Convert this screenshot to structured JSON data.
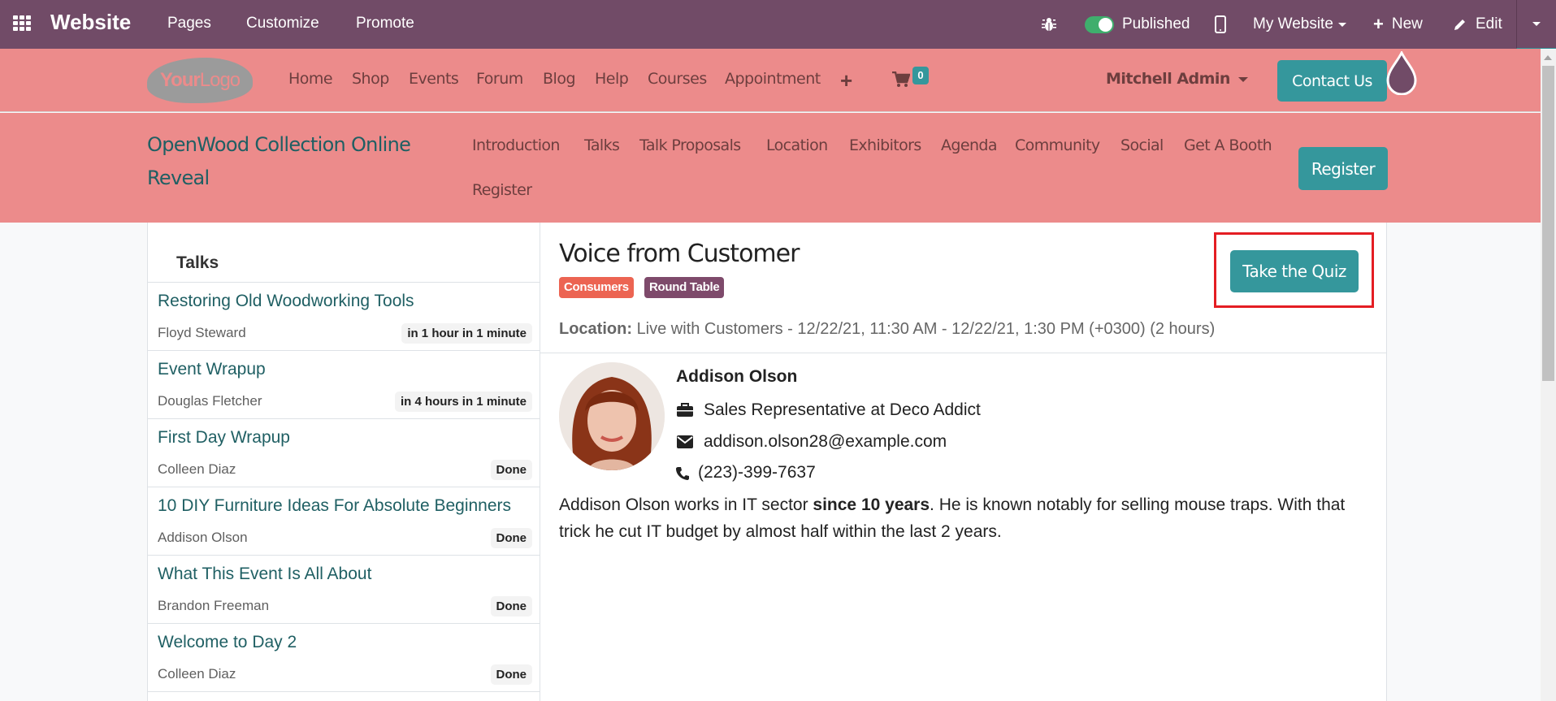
{
  "topbar": {
    "app_name": "Website",
    "menus": [
      "Pages",
      "Customize",
      "Promote"
    ],
    "published_label": "Published",
    "published": true,
    "website_selector": "My Website",
    "new_label": "New",
    "edit_label": "Edit"
  },
  "site_header": {
    "logo_text_bold": "Your",
    "logo_text_light": "Logo",
    "nav": [
      "Home",
      "Shop",
      "Events",
      "Forum",
      "Blog",
      "Help",
      "Courses",
      "Appointment"
    ],
    "cart_count": "0",
    "user_name": "Mitchell Admin",
    "contact_label": "Contact Us"
  },
  "event_header": {
    "title": "OpenWood Collection Online Reveal",
    "nav": [
      "Introduction",
      "Talks",
      "Talk Proposals",
      "Location",
      "Exhibitors",
      "Agenda",
      "Community",
      "Social",
      "Get A Booth",
      "Register"
    ],
    "register_label": "Register"
  },
  "sidebar": {
    "heading": "Talks",
    "talks": [
      {
        "title": "Restoring Old Woodworking Tools",
        "speaker": "Floyd Steward",
        "status": "in 1 hour in 1 minute"
      },
      {
        "title": "Event Wrapup",
        "speaker": "Douglas Fletcher",
        "status": "in 4 hours in 1 minute"
      },
      {
        "title": "First Day Wrapup",
        "speaker": "Colleen Diaz",
        "status": "Done"
      },
      {
        "title": "10 DIY Furniture Ideas For Absolute Beginners",
        "speaker": "Addison Olson",
        "status": "Done"
      },
      {
        "title": "What This Event Is All About",
        "speaker": "Brandon Freeman",
        "status": "Done"
      },
      {
        "title": "Welcome to Day 2",
        "speaker": "Colleen Diaz",
        "status": "Done"
      }
    ]
  },
  "talk": {
    "title": "Voice from Customer",
    "tags": [
      {
        "label": "Consumers",
        "color": "#ec6452"
      },
      {
        "label": "Round Table",
        "color": "#7e4a6b"
      }
    ],
    "quiz_label": "Take the Quiz",
    "location_label": "Location:",
    "location_value": "Live with Customers - 12/22/21, 11:30 AM - 12/22/21, 1:30 PM (+0300) (2 hours)",
    "speaker": {
      "name": "Addison Olson",
      "job": "Sales Representative at Deco Addict",
      "email": "addison.olson28@example.com",
      "phone": "(223)-399-7637"
    },
    "bio_before": "Addison Olson works in IT sector ",
    "bio_bold": "since 10 years",
    "bio_after": ". He is known notably for selling mouse traps. With that trick he cut IT budget by almost half within the last 2 years."
  },
  "colors": {
    "topbar": "#714B67",
    "header": "#ec8b8b",
    "primary": "#35979c",
    "highlight": "#e41d23"
  }
}
